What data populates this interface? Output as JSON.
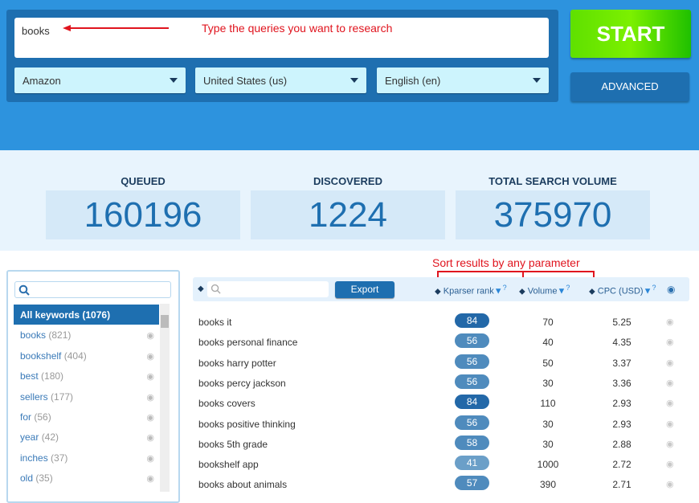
{
  "query": {
    "value": "books"
  },
  "annotations": {
    "query_hint": "Type the queries you want to research",
    "sort_hint": "Sort results by any parameter"
  },
  "selects": [
    {
      "value": "Amazon"
    },
    {
      "value": "United States (us)"
    },
    {
      "value": "English (en)"
    }
  ],
  "buttons": {
    "start": "START",
    "advanced": "ADVANCED",
    "export": "Export"
  },
  "stats": [
    {
      "label": "QUEUED",
      "value": "160196"
    },
    {
      "label": "DISCOVERED",
      "value": "1224"
    },
    {
      "label": "TOTAL SEARCH VOLUME",
      "value": "375970"
    }
  ],
  "sidebar": {
    "items": [
      {
        "label": "All keywords",
        "count": "(1076)"
      },
      {
        "label": "books",
        "count": "(821)"
      },
      {
        "label": "bookshelf",
        "count": "(404)"
      },
      {
        "label": "best",
        "count": "(180)"
      },
      {
        "label": "sellers",
        "count": "(177)"
      },
      {
        "label": "for",
        "count": "(56)"
      },
      {
        "label": "year",
        "count": "(42)"
      },
      {
        "label": "inches",
        "count": "(37)"
      },
      {
        "label": "old",
        "count": "(35)"
      }
    ]
  },
  "table": {
    "columns": [
      "Kparser rank",
      "Volume",
      "CPC (USD)"
    ],
    "rows": [
      {
        "keyword": "books it",
        "rank": "84",
        "volume": "70",
        "cpc": "5.25"
      },
      {
        "keyword": "books personal finance",
        "rank": "56",
        "volume": "40",
        "cpc": "4.35"
      },
      {
        "keyword": "books harry potter",
        "rank": "56",
        "volume": "50",
        "cpc": "3.37"
      },
      {
        "keyword": "books percy jackson",
        "rank": "56",
        "volume": "30",
        "cpc": "3.36"
      },
      {
        "keyword": "books covers",
        "rank": "84",
        "volume": "110",
        "cpc": "2.93"
      },
      {
        "keyword": "books positive thinking",
        "rank": "56",
        "volume": "30",
        "cpc": "2.93"
      },
      {
        "keyword": "books 5th grade",
        "rank": "58",
        "volume": "30",
        "cpc": "2.88"
      },
      {
        "keyword": "bookshelf app",
        "rank": "41",
        "volume": "1000",
        "cpc": "2.72"
      },
      {
        "keyword": "books about animals",
        "rank": "57",
        "volume": "390",
        "cpc": "2.71"
      }
    ]
  },
  "colors": {
    "header_blue": "#2d93de",
    "panel_blue": "#1e6fb0",
    "start_green": "#5fe000",
    "annotation_red": "#e0141e"
  }
}
